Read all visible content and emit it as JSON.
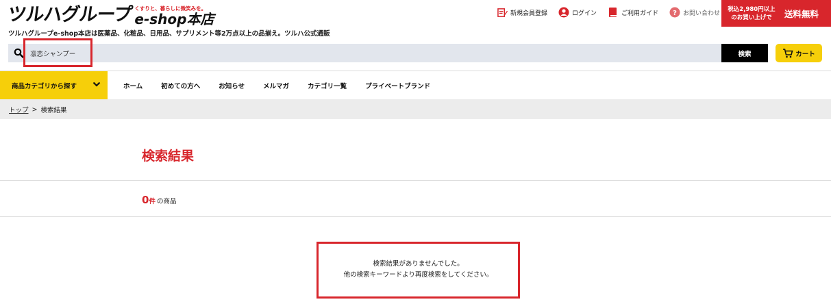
{
  "header": {
    "logo_main": "ツルハグループ",
    "logo_tagline": "くすりと、暮らしに微笑みを。",
    "logo_shop": "e-shop本店",
    "site_description": "ツルハグループe-shop本店は医薬品、化粧品、日用品、サプリメント等2万点以上の品揃え。ツルハ公式通販",
    "top_links": [
      {
        "label": "新規会員登録",
        "icon": "member-register-icon"
      },
      {
        "label": "ログイン",
        "icon": "login-icon"
      },
      {
        "label": "ご利用ガイド",
        "icon": "guide-book-icon"
      },
      {
        "label": "お問い合わせ",
        "icon": "question-icon"
      }
    ],
    "shipping_line1": "税込2,980円以上",
    "shipping_line2": "のお買い上げで",
    "shipping_free": "送料無料"
  },
  "search": {
    "value": "凛恋シャンプー",
    "button_label": "検索"
  },
  "cart": {
    "label": "カート"
  },
  "nav": {
    "category_button": "商品カテゴリから探す",
    "items": [
      "ホーム",
      "初めての方へ",
      "お知らせ",
      "メルマガ",
      "カテゴリ一覧",
      "プライベートブランド"
    ]
  },
  "breadcrumb": {
    "home": "トップ",
    "separator": ">",
    "current": "検索結果"
  },
  "main": {
    "title": "検索結果",
    "count_number": "0",
    "count_unit": "件",
    "count_label": "の商品",
    "no_result_line1": "検索結果がありませんでした。",
    "no_result_line2": "他の検索キーワードより再度検索をしてください。"
  },
  "colors": {
    "accent_red": "#d8262c",
    "accent_yellow": "#f6cf0a",
    "search_bg": "#e2e6ed"
  }
}
